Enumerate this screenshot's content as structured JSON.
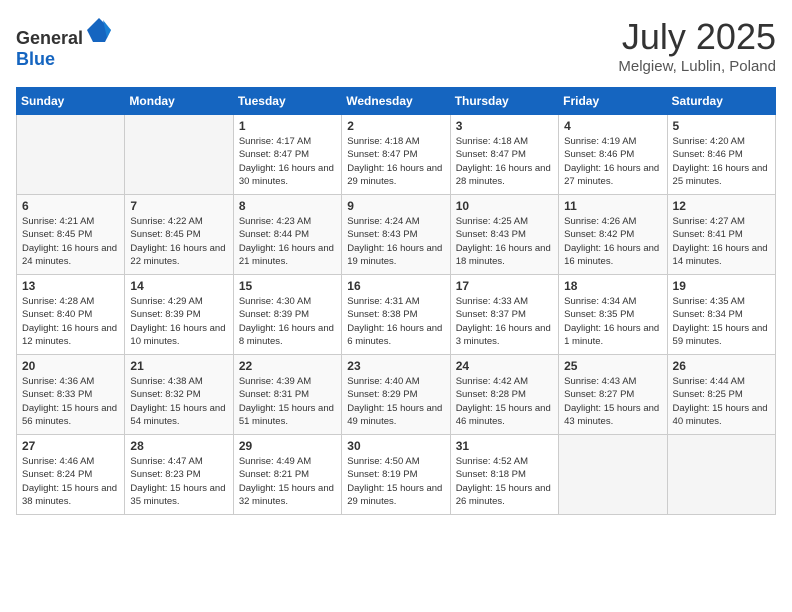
{
  "header": {
    "logo_general": "General",
    "logo_blue": "Blue",
    "month_year": "July 2025",
    "location": "Melgiew, Lublin, Poland"
  },
  "days_of_week": [
    "Sunday",
    "Monday",
    "Tuesday",
    "Wednesday",
    "Thursday",
    "Friday",
    "Saturday"
  ],
  "weeks": [
    [
      {
        "day": "",
        "info": ""
      },
      {
        "day": "",
        "info": ""
      },
      {
        "day": "1",
        "info": "Sunrise: 4:17 AM\nSunset: 8:47 PM\nDaylight: 16 hours and 30 minutes."
      },
      {
        "day": "2",
        "info": "Sunrise: 4:18 AM\nSunset: 8:47 PM\nDaylight: 16 hours and 29 minutes."
      },
      {
        "day": "3",
        "info": "Sunrise: 4:18 AM\nSunset: 8:47 PM\nDaylight: 16 hours and 28 minutes."
      },
      {
        "day": "4",
        "info": "Sunrise: 4:19 AM\nSunset: 8:46 PM\nDaylight: 16 hours and 27 minutes."
      },
      {
        "day": "5",
        "info": "Sunrise: 4:20 AM\nSunset: 8:46 PM\nDaylight: 16 hours and 25 minutes."
      }
    ],
    [
      {
        "day": "6",
        "info": "Sunrise: 4:21 AM\nSunset: 8:45 PM\nDaylight: 16 hours and 24 minutes."
      },
      {
        "day": "7",
        "info": "Sunrise: 4:22 AM\nSunset: 8:45 PM\nDaylight: 16 hours and 22 minutes."
      },
      {
        "day": "8",
        "info": "Sunrise: 4:23 AM\nSunset: 8:44 PM\nDaylight: 16 hours and 21 minutes."
      },
      {
        "day": "9",
        "info": "Sunrise: 4:24 AM\nSunset: 8:43 PM\nDaylight: 16 hours and 19 minutes."
      },
      {
        "day": "10",
        "info": "Sunrise: 4:25 AM\nSunset: 8:43 PM\nDaylight: 16 hours and 18 minutes."
      },
      {
        "day": "11",
        "info": "Sunrise: 4:26 AM\nSunset: 8:42 PM\nDaylight: 16 hours and 16 minutes."
      },
      {
        "day": "12",
        "info": "Sunrise: 4:27 AM\nSunset: 8:41 PM\nDaylight: 16 hours and 14 minutes."
      }
    ],
    [
      {
        "day": "13",
        "info": "Sunrise: 4:28 AM\nSunset: 8:40 PM\nDaylight: 16 hours and 12 minutes."
      },
      {
        "day": "14",
        "info": "Sunrise: 4:29 AM\nSunset: 8:39 PM\nDaylight: 16 hours and 10 minutes."
      },
      {
        "day": "15",
        "info": "Sunrise: 4:30 AM\nSunset: 8:39 PM\nDaylight: 16 hours and 8 minutes."
      },
      {
        "day": "16",
        "info": "Sunrise: 4:31 AM\nSunset: 8:38 PM\nDaylight: 16 hours and 6 minutes."
      },
      {
        "day": "17",
        "info": "Sunrise: 4:33 AM\nSunset: 8:37 PM\nDaylight: 16 hours and 3 minutes."
      },
      {
        "day": "18",
        "info": "Sunrise: 4:34 AM\nSunset: 8:35 PM\nDaylight: 16 hours and 1 minute."
      },
      {
        "day": "19",
        "info": "Sunrise: 4:35 AM\nSunset: 8:34 PM\nDaylight: 15 hours and 59 minutes."
      }
    ],
    [
      {
        "day": "20",
        "info": "Sunrise: 4:36 AM\nSunset: 8:33 PM\nDaylight: 15 hours and 56 minutes."
      },
      {
        "day": "21",
        "info": "Sunrise: 4:38 AM\nSunset: 8:32 PM\nDaylight: 15 hours and 54 minutes."
      },
      {
        "day": "22",
        "info": "Sunrise: 4:39 AM\nSunset: 8:31 PM\nDaylight: 15 hours and 51 minutes."
      },
      {
        "day": "23",
        "info": "Sunrise: 4:40 AM\nSunset: 8:29 PM\nDaylight: 15 hours and 49 minutes."
      },
      {
        "day": "24",
        "info": "Sunrise: 4:42 AM\nSunset: 8:28 PM\nDaylight: 15 hours and 46 minutes."
      },
      {
        "day": "25",
        "info": "Sunrise: 4:43 AM\nSunset: 8:27 PM\nDaylight: 15 hours and 43 minutes."
      },
      {
        "day": "26",
        "info": "Sunrise: 4:44 AM\nSunset: 8:25 PM\nDaylight: 15 hours and 40 minutes."
      }
    ],
    [
      {
        "day": "27",
        "info": "Sunrise: 4:46 AM\nSunset: 8:24 PM\nDaylight: 15 hours and 38 minutes."
      },
      {
        "day": "28",
        "info": "Sunrise: 4:47 AM\nSunset: 8:23 PM\nDaylight: 15 hours and 35 minutes."
      },
      {
        "day": "29",
        "info": "Sunrise: 4:49 AM\nSunset: 8:21 PM\nDaylight: 15 hours and 32 minutes."
      },
      {
        "day": "30",
        "info": "Sunrise: 4:50 AM\nSunset: 8:19 PM\nDaylight: 15 hours and 29 minutes."
      },
      {
        "day": "31",
        "info": "Sunrise: 4:52 AM\nSunset: 8:18 PM\nDaylight: 15 hours and 26 minutes."
      },
      {
        "day": "",
        "info": ""
      },
      {
        "day": "",
        "info": ""
      }
    ]
  ]
}
